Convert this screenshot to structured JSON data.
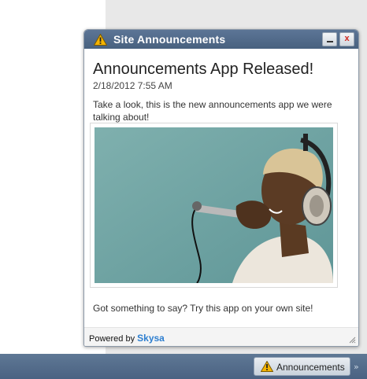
{
  "popup": {
    "title": "Site Announcements",
    "minimize_label": "_",
    "close_label": "x",
    "headline": "Announcements App Released!",
    "date": "2/18/2012 7:55 AM",
    "body": "Take a look, this is the new announcements app we were talking about!",
    "image_alt": "person-singing-into-microphone",
    "cta": "Got something to say? Try this app on your own site!",
    "footer_prefix": "Powered by",
    "footer_brand": "Skysa"
  },
  "taskbar": {
    "button_label": "Announcements",
    "more_label": "»"
  },
  "icons": {
    "title_icon": "warning-icon",
    "button_icon": "warning-icon"
  },
  "colors": {
    "titlebar": "#4e6788",
    "brand": "#2e7fd0",
    "close": "#d0281f",
    "photo_bg": "#6fa3a3"
  }
}
